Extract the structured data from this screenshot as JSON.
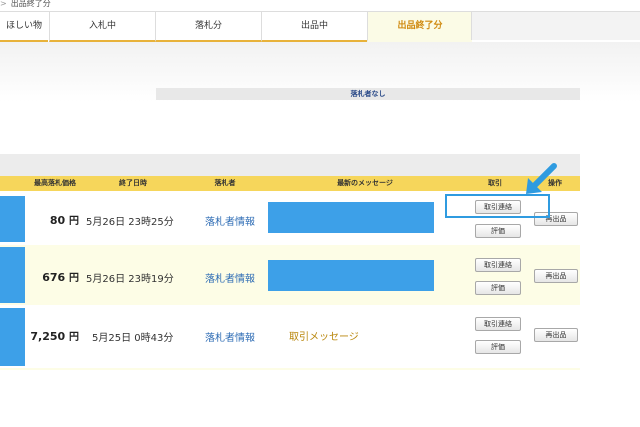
{
  "breadcrumb": "出品終了分",
  "tabs": [
    {
      "label": "ほしい物"
    },
    {
      "label": "入札中"
    },
    {
      "label": "落札分"
    },
    {
      "label": "出品中"
    },
    {
      "label": "出品終了分"
    }
  ],
  "no_winner_notice": "落札者なし",
  "table": {
    "headers": {
      "highest_price": "最高落札価格",
      "end_datetime": "終了日時",
      "winner": "落札者",
      "latest_message": "最新のメッセージ",
      "transaction": "取引",
      "operation": "操作"
    },
    "rows": [
      {
        "price": "80",
        "unit": "円",
        "end": "5月26日 23時25分",
        "winner_link": "落札者情報",
        "message": "",
        "contact_btn": "取引連絡",
        "rate_btn": "評価",
        "relist_btn": "再出品"
      },
      {
        "price": "676",
        "unit": "円",
        "end": "5月26日 23時19分",
        "winner_link": "落札者情報",
        "message": "",
        "contact_btn": "取引連絡",
        "rate_btn": "評価",
        "relist_btn": "再出品"
      },
      {
        "price": "7,250",
        "unit": "円",
        "end": "5月25日 0時43分",
        "winner_link": "落札者情報",
        "message": "取引メッセージ",
        "contact_btn": "取引連絡",
        "rate_btn": "評価",
        "relist_btn": "再出品"
      }
    ]
  },
  "colors": {
    "accent_blue": "#3da0e8",
    "header_yellow": "#f6d65b",
    "active_tab_text": "#d08a10",
    "arrow": "#2f9be0"
  }
}
